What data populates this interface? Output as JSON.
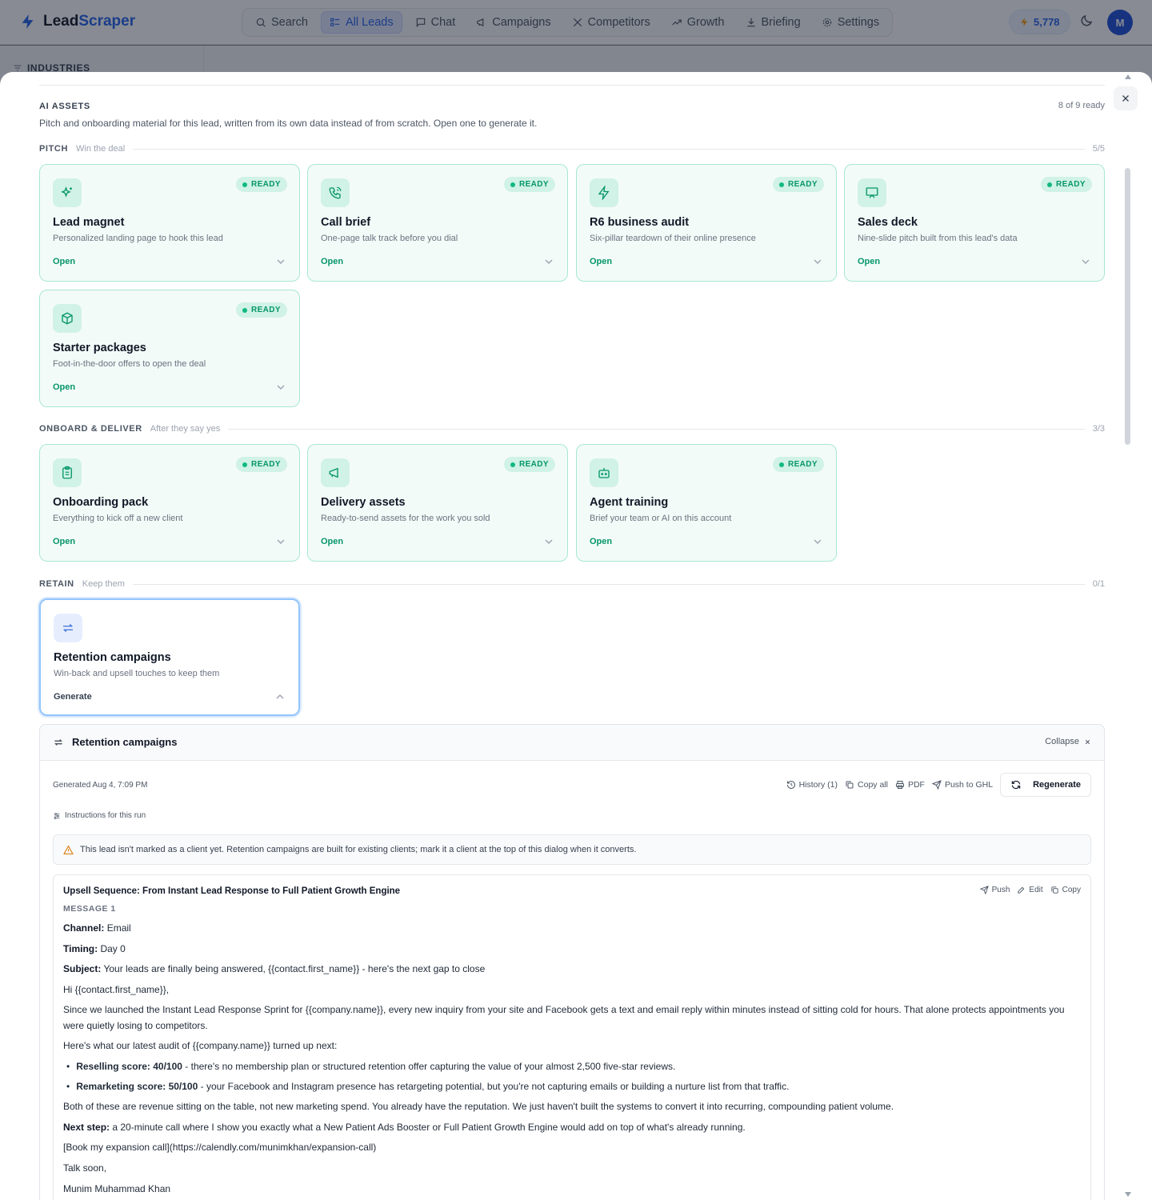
{
  "app": {
    "brand_prefix": "Lead",
    "brand_suffix": "Scraper",
    "nav": [
      "Search",
      "All Leads",
      "Chat",
      "Campaigns",
      "Competitors",
      "Growth",
      "Briefing",
      "Settings"
    ],
    "active_nav": "All Leads",
    "credits": "5,778",
    "avatar_initial": "M",
    "sidebar_heading": "INDUSTRIES"
  },
  "assets": {
    "title": "AI ASSETS",
    "ready_count": "8 of 9 ready",
    "description": "Pitch and onboarding material for this lead, written from its own data instead of from scratch. Open one to generate it."
  },
  "sections": [
    {
      "name": "PITCH",
      "subtitle": "Win the deal",
      "count": "5/5",
      "cards": [
        {
          "title": "Lead magnet",
          "desc": "Personalized landing page to hook this lead",
          "action": "Open",
          "status": "READY",
          "icon": "sparkles-icon"
        },
        {
          "title": "Call brief",
          "desc": "One-page talk track before you dial",
          "action": "Open",
          "status": "READY",
          "icon": "phone-icon"
        },
        {
          "title": "R6 business audit",
          "desc": "Six-pillar teardown of their online presence",
          "action": "Open",
          "status": "READY",
          "icon": "bolt-icon"
        },
        {
          "title": "Sales deck",
          "desc": "Nine-slide pitch built from this lead's data",
          "action": "Open",
          "status": "READY",
          "icon": "presentation-icon"
        },
        {
          "title": "Starter packages",
          "desc": "Foot-in-the-door offers to open the deal",
          "action": "Open",
          "status": "READY",
          "icon": "package-icon"
        }
      ]
    },
    {
      "name": "ONBOARD & DELIVER",
      "subtitle": "After they say yes",
      "count": "3/3",
      "cards": [
        {
          "title": "Onboarding pack",
          "desc": "Everything to kick off a new client",
          "action": "Open",
          "status": "READY",
          "icon": "clipboard-icon"
        },
        {
          "title": "Delivery assets",
          "desc": "Ready-to-send assets for the work you sold",
          "action": "Open",
          "status": "READY",
          "icon": "megaphone-icon"
        },
        {
          "title": "Agent training",
          "desc": "Brief your team or AI on this account",
          "action": "Open",
          "status": "READY",
          "icon": "bot-icon"
        }
      ]
    },
    {
      "name": "RETAIN",
      "subtitle": "Keep them",
      "count": "0/1",
      "cards": [
        {
          "title": "Retention campaigns",
          "desc": "Win-back and upsell touches to keep them",
          "action": "Generate",
          "status": "",
          "icon": "repeat-icon"
        }
      ]
    }
  ],
  "panel": {
    "title": "Retention campaigns",
    "collapse": "Collapse",
    "generated": "Generated Aug 4, 7:09 PM",
    "toolbar": {
      "history": "History (1)",
      "copy_all": "Copy all",
      "pdf": "PDF",
      "push_ghl": "Push to GHL",
      "regenerate": "Regenerate"
    },
    "instructions": "Instructions for this run",
    "warning": "This lead isn't marked as a client yet. Retention campaigns are built for existing clients; mark it a client at the top of this dialog when it converts.",
    "message": {
      "title": "Upsell Sequence: From Instant Lead Response to Full Patient Growth Engine",
      "tools": {
        "push": "Push",
        "edit": "Edit",
        "copy": "Copy"
      },
      "label": "MESSAGE 1",
      "channel_label": "Channel:",
      "channel": "Email",
      "timing_label": "Timing:",
      "timing": "Day 0",
      "subject_label": "Subject:",
      "subject": "Your leads are finally being answered, {{contact.first_name}} - here's the next gap to close",
      "greeting": "Hi {{contact.first_name}},",
      "para1": "Since we launched the Instant Lead Response Sprint for {{company.name}}, every new inquiry from your site and Facebook gets a text and email reply within minutes instead of sitting cold for hours. That alone protects appointments you were quietly losing to competitors.",
      "para2": "Here's what our latest audit of {{company.name}} turned up next:",
      "bullet1_label": "Reselling score: 40/100",
      "bullet1_text": " - there's no membership plan or structured retention offer capturing the value of your almost 2,500 five-star reviews.",
      "bullet2_label": "Remarketing score: 50/100",
      "bullet2_text": " - your Facebook and Instagram presence has retargeting potential, but you're not capturing emails or building a nurture list from that traffic.",
      "para3": "Both of these are revenue sitting on the table, not new marketing spend. You already have the reputation. We just haven't built the systems to convert it into recurring, compounding patient volume.",
      "next_label": "Next step:",
      "next_text": " a 20-minute call where I show you exactly what a New Patient Ads Booster or Full Patient Growth Engine would add on top of what's already running.",
      "link": "[Book my expansion call](https://calendly.com/munimkhan/expansion-call)",
      "signoff": "Talk soon,",
      "signature": "Munim Muhammad Khan"
    }
  }
}
